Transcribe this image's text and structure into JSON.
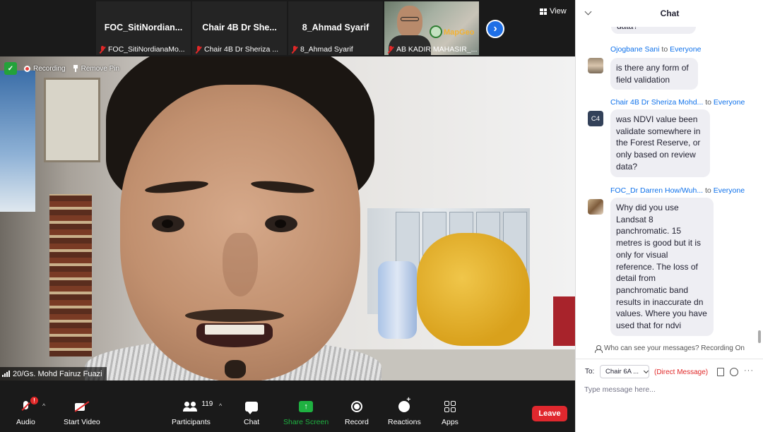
{
  "top_strip": {
    "tiles": [
      {
        "name": "FOC_SitiNordian...",
        "sub": "FOC_SitiNordianaMo..."
      },
      {
        "name": "Chair 4B Dr She...",
        "sub": "Chair 4B Dr Sheriza ..."
      },
      {
        "name": "8_Ahmad Syarif",
        "sub": "8_Ahmad Syarif"
      },
      {
        "name": "",
        "sub": "AB KADIR MAHASIR_..."
      }
    ],
    "mapgeo_text": "MapGeo",
    "next_symbol": "›",
    "view_label": "View"
  },
  "main_video": {
    "recording_label": "Recording",
    "remove_pin_label": "Remove Pin",
    "speaker_name": "20/Gs. Mohd Fairuz Fuazi"
  },
  "toolbar": {
    "audio_label": "Audio",
    "audio_badge": "!",
    "start_video_label": "Start Video",
    "participants_label": "Participants",
    "participants_count": "119",
    "chat_label": "Chat",
    "share_screen_label": "Share Screen",
    "share_symbol": "↑",
    "record_label": "Record",
    "reactions_label": "Reactions",
    "apps_label": "Apps",
    "leave_label": "Leave",
    "caret": "^"
  },
  "chat": {
    "title": "Chat",
    "clipped_text": "data?",
    "messages": [
      {
        "sender": "Ojogbane Sani",
        "to": "to",
        "recipient": "Everyone",
        "avatar": "",
        "text": "is there any form of field validation"
      },
      {
        "sender": "Chair 4B Dr Sheriza Mohd...",
        "to": "to",
        "recipient": "Everyone",
        "avatar": "C4",
        "text": "was NDVI value been validate somewhere in the Forest Reserve, or only based on review data?"
      },
      {
        "sender": "FOC_Dr Darren How/Wuh...",
        "to": "to",
        "recipient": "Everyone",
        "avatar": "",
        "text": "Why did you use Landsat 8 panchromatic. 15 metres is good but it is only for visual reference. The loss of detail from panchromatic band results in inaccurate dn values. Where you have used that for ndvi"
      }
    ],
    "visibility_note": "Who can see your messages? Recording On",
    "compose": {
      "to_label": "To:",
      "to_value": "Chair 6A ...",
      "direct_message": "(Direct Message)",
      "more": "···",
      "placeholder": "Type message here..."
    }
  }
}
